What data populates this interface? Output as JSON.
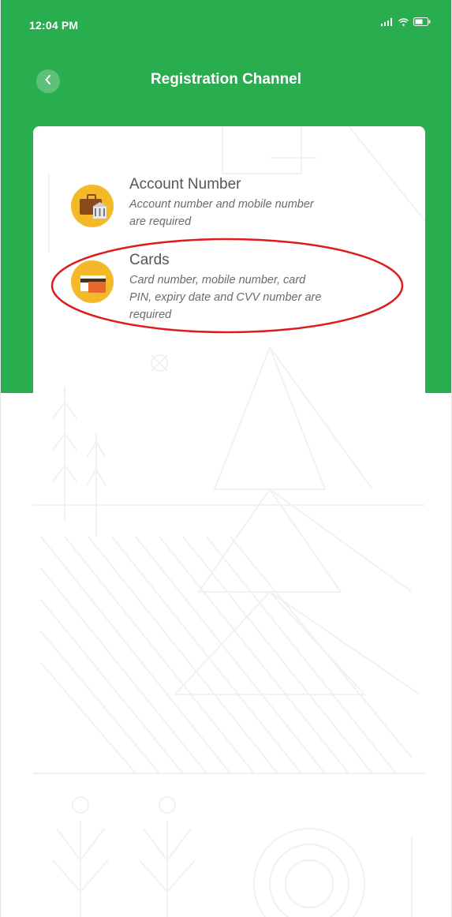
{
  "status_bar": {
    "time": "12:04 PM",
    "icons": [
      "signal-icon",
      "wifi-icon",
      "battery-icon"
    ]
  },
  "header": {
    "title": "Registration Channel",
    "back_icon": "chevron-left-icon"
  },
  "options": [
    {
      "title": "Account Number",
      "description_line1": "Account number and mobile number",
      "description_line2": "are required",
      "icon": "briefcase-bank-icon"
    },
    {
      "title": "Cards",
      "description_line1": "Card number, mobile number, card",
      "description_line2": "PIN, expiry date and CVV number are",
      "description_line3": "required",
      "icon": "credit-card-icon"
    }
  ],
  "colors": {
    "header_green": "#28ad4f",
    "icon_yellow": "#f4b928",
    "highlight_red": "#e01b1b"
  }
}
